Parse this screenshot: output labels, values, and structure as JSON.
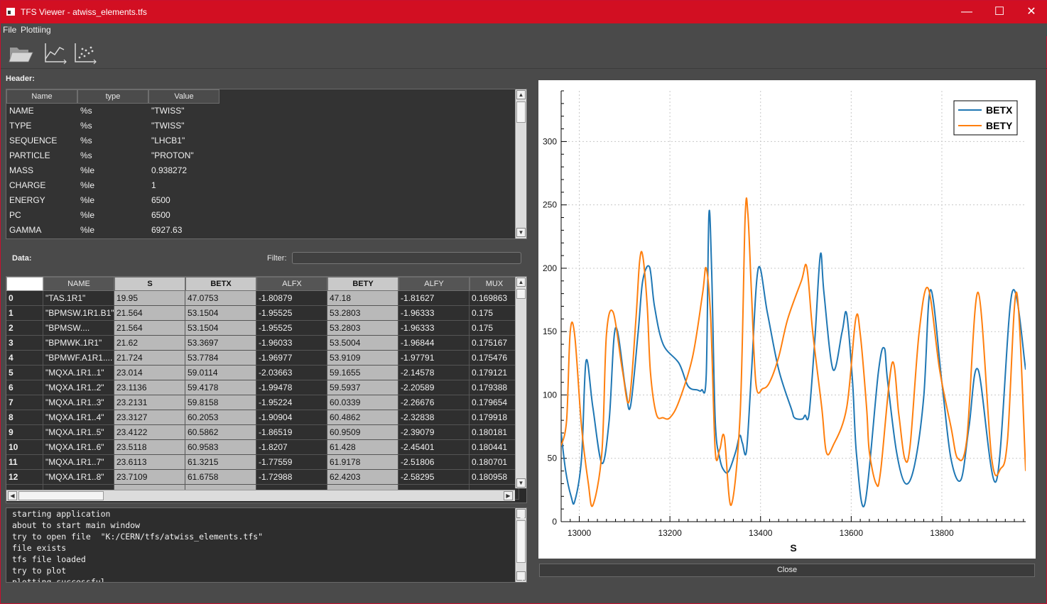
{
  "window": {
    "title": "TFS Viewer - atwiss_elements.tfs",
    "controls": [
      "—",
      "☐",
      "✕"
    ]
  },
  "menu": {
    "file": "File",
    "plotting": "Plottiing"
  },
  "toolbar": {
    "icons": [
      "folder-open-icon",
      "line-plot-icon",
      "scatter-plot-icon"
    ]
  },
  "header_section": {
    "label": "Header:",
    "columns": [
      "Name",
      "type",
      "Value"
    ],
    "rows": [
      [
        "NAME",
        "%s",
        "\"TWISS\""
      ],
      [
        "TYPE",
        "%s",
        "\"TWISS\""
      ],
      [
        "SEQUENCE",
        "%s",
        "\"LHCB1\""
      ],
      [
        "PARTICLE",
        "%s",
        "\"PROTON\""
      ],
      [
        "MASS",
        "%le",
        "0.938272"
      ],
      [
        "CHARGE",
        "%le",
        "1"
      ],
      [
        "ENERGY",
        "%le",
        "6500"
      ],
      [
        "PC",
        "%le",
        "6500"
      ],
      [
        "GAMMA",
        "%le",
        "6927.63"
      ]
    ]
  },
  "data_section": {
    "label": "Data:",
    "filter_label": "Filter:",
    "filter_value": "",
    "columns": [
      "NAME",
      "S",
      "BETX",
      "ALFX",
      "BETY",
      "ALFY",
      "MUX"
    ],
    "rows": [
      [
        "0",
        "\"TAS.1R1\"",
        "19.95",
        "47.0753",
        "-1.80879",
        "47.18",
        "-1.81627",
        "0.169863"
      ],
      [
        "1",
        "\"BPMSW.1R1.B1\"",
        "21.564",
        "53.1504",
        "-1.95525",
        "53.2803",
        "-1.96333",
        "0.175"
      ],
      [
        "2",
        "\"BPMSW....",
        "21.564",
        "53.1504",
        "-1.95525",
        "53.2803",
        "-1.96333",
        "0.175"
      ],
      [
        "3",
        "\"BPMWK.1R1\"",
        "21.62",
        "53.3697",
        "-1.96033",
        "53.5004",
        "-1.96844",
        "0.175167"
      ],
      [
        "4",
        "\"BPMWF.A1R1....",
        "21.724",
        "53.7784",
        "-1.96977",
        "53.9109",
        "-1.97791",
        "0.175476"
      ],
      [
        "5",
        "\"MQXA.1R1..1\"",
        "23.014",
        "59.0114",
        "-2.03663",
        "59.1655",
        "-2.14578",
        "0.179121"
      ],
      [
        "6",
        "\"MQXA.1R1..2\"",
        "23.1136",
        "59.4178",
        "-1.99478",
        "59.5937",
        "-2.20589",
        "0.179388"
      ],
      [
        "7",
        "\"MQXA.1R1..3\"",
        "23.2131",
        "59.8158",
        "-1.95224",
        "60.0339",
        "-2.26676",
        "0.179654"
      ],
      [
        "8",
        "\"MQXA.1R1..4\"",
        "23.3127",
        "60.2053",
        "-1.90904",
        "60.4862",
        "-2.32838",
        "0.179918"
      ],
      [
        "9",
        "\"MQXA.1R1..5\"",
        "23.4122",
        "60.5862",
        "-1.86519",
        "60.9509",
        "-2.39079",
        "0.180181"
      ],
      [
        "10",
        "\"MQXA.1R1..6\"",
        "23.5118",
        "60.9583",
        "-1.8207",
        "61.428",
        "-2.45401",
        "0.180441"
      ],
      [
        "11",
        "\"MQXA.1R1..7\"",
        "23.6113",
        "61.3215",
        "-1.77559",
        "61.9178",
        "-2.51806",
        "0.180701"
      ],
      [
        "12",
        "\"MQXA.1R1..8\"",
        "23.7109",
        "61.6758",
        "-1.72988",
        "62.4203",
        "-2.58295",
        "0.180958"
      ]
    ]
  },
  "log": [
    "starting application",
    "about to start main window",
    "try to open file  \"K:/CERN/tfs/atwiss_elements.tfs\"",
    "file exists",
    "tfs file loaded",
    "try to plot",
    "plotting successful"
  ],
  "close_label": "Close",
  "chart_data": {
    "type": "line",
    "xlabel": "S",
    "ylabel": "",
    "xlim": [
      12960,
      13985
    ],
    "ylim": [
      0,
      340
    ],
    "xticks": [
      13000,
      13200,
      13400,
      13600,
      13800
    ],
    "yticks": [
      0,
      50,
      100,
      150,
      200,
      250,
      300
    ],
    "grid": true,
    "legend": "top-right",
    "series": [
      {
        "name": "BETX",
        "color": "#1f77b4",
        "x": [
          12960,
          12970,
          12982,
          12990,
          13005,
          13015,
          13030,
          13050,
          13066,
          13080,
          13102,
          13113,
          13130,
          13140,
          13155,
          13166,
          13185,
          13220,
          13240,
          13260,
          13270,
          13280,
          13286,
          13292,
          13300,
          13310,
          13320,
          13330,
          13345,
          13354,
          13360,
          13369,
          13380,
          13395,
          13415,
          13440,
          13468,
          13475,
          13492,
          13498,
          13507,
          13520,
          13532,
          13540,
          13560,
          13580,
          13590,
          13603,
          13612,
          13630,
          13660,
          13673,
          13680,
          13700,
          13720,
          13740,
          13760,
          13775,
          13800,
          13820,
          13842,
          13860,
          13880,
          13920,
          13955,
          13985
        ],
        "y": [
          70,
          40,
          20,
          16,
          50,
          127,
          90,
          46,
          80,
          153,
          105,
          91,
          150,
          190,
          201,
          170,
          140,
          125,
          107,
          104,
          104,
          115,
          242,
          200,
          80,
          50,
          40,
          40,
          55,
          68,
          62,
          56,
          118,
          200,
          165,
          120,
          89,
          82,
          81,
          84,
          85,
          145,
          211,
          180,
          120,
          150,
          164,
          110,
          52,
          14,
          118,
          137,
          112,
          55,
          30,
          45,
          98,
          183,
          110,
          50,
          33,
          75,
          120,
          32,
          181,
          120
        ]
      },
      {
        "name": "BETY",
        "color": "#ff7f0e",
        "x": [
          12960,
          12972,
          12980,
          12990,
          13005,
          13020,
          13030,
          13050,
          13060,
          13075,
          13095,
          13110,
          13125,
          13133,
          13140,
          13150,
          13157,
          13170,
          13185,
          13200,
          13220,
          13250,
          13272,
          13280,
          13290,
          13300,
          13310,
          13320,
          13335,
          13355,
          13366,
          13372,
          13380,
          13390,
          13405,
          13420,
          13440,
          13460,
          13490,
          13502,
          13515,
          13535,
          13545,
          13560,
          13590,
          13610,
          13620,
          13634,
          13640,
          13655,
          13665,
          13690,
          13705,
          13718,
          13730,
          13750,
          13770,
          13795,
          13820,
          13835,
          13855,
          13880,
          13910,
          13930,
          13945,
          13965,
          13985
        ],
        "y": [
          60,
          80,
          150,
          147,
          75,
          30,
          13,
          55,
          148,
          165,
          120,
          95,
          160,
          205,
          210,
          170,
          118,
          85,
          82,
          82,
          95,
          130,
          180,
          200,
          160,
          56,
          57,
          67,
          13,
          85,
          240,
          243,
          180,
          108,
          105,
          110,
          130,
          160,
          190,
          201,
          150,
          90,
          55,
          60,
          90,
          160,
          148,
          90,
          55,
          30,
          40,
          125,
          85,
          50,
          60,
          150,
          184,
          120,
          75,
          50,
          65,
          181,
          50,
          42,
          65,
          181,
          40
        ]
      }
    ]
  }
}
